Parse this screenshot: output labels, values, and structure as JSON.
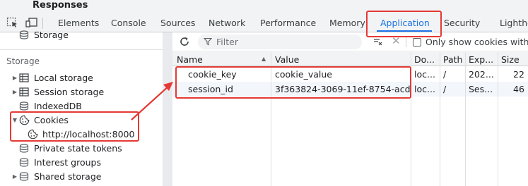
{
  "window": {
    "title": "Responses"
  },
  "tabs": [
    {
      "label": "Elements",
      "active": false
    },
    {
      "label": "Console",
      "active": false
    },
    {
      "label": "Sources",
      "active": false
    },
    {
      "label": "Network",
      "active": false
    },
    {
      "label": "Performance",
      "active": false
    },
    {
      "label": "Memory",
      "active": false
    },
    {
      "label": "Application",
      "active": true
    },
    {
      "label": "Security",
      "active": false
    },
    {
      "label": "Lightho",
      "active": false
    }
  ],
  "sidebar": {
    "partial_item": "Storage",
    "section_title": "Storage",
    "items": [
      {
        "label": "Local storage",
        "icon": "table-icon",
        "expandable": true,
        "expanded": false
      },
      {
        "label": "Session storage",
        "icon": "table-icon",
        "expandable": true,
        "expanded": false
      },
      {
        "label": "IndexedDB",
        "icon": "database-icon",
        "expandable": false
      },
      {
        "label": "Cookies",
        "icon": "cookie-icon",
        "expandable": true,
        "expanded": true
      },
      {
        "label": "http://localhost:8000",
        "icon": "cookie-icon",
        "child": true
      },
      {
        "label": "Private state tokens",
        "icon": "database-icon",
        "expandable": false
      },
      {
        "label": "Interest groups",
        "icon": "database-icon",
        "expandable": false
      },
      {
        "label": "Shared storage",
        "icon": "database-icon",
        "expandable": true,
        "expanded": false
      }
    ]
  },
  "toolbar": {
    "filter_placeholder": "Filter",
    "only_show_label": "Only show cookies with a"
  },
  "table": {
    "columns": [
      "Name",
      "Value",
      "Do...",
      "Path",
      "Exp...",
      "Size"
    ],
    "rows": [
      {
        "name": "cookie_key",
        "value": "cookie_value",
        "domain": "loc...",
        "path": "/",
        "expires": "202...",
        "size": "22"
      },
      {
        "name": "session_id",
        "value": "3f363824-3069-11ef-8754-acd...",
        "domain": "loc...",
        "path": "/",
        "expires": "Ses...",
        "size": "46"
      }
    ]
  },
  "colors": {
    "accent": "#1a73e8",
    "annotation": "#e53935"
  }
}
